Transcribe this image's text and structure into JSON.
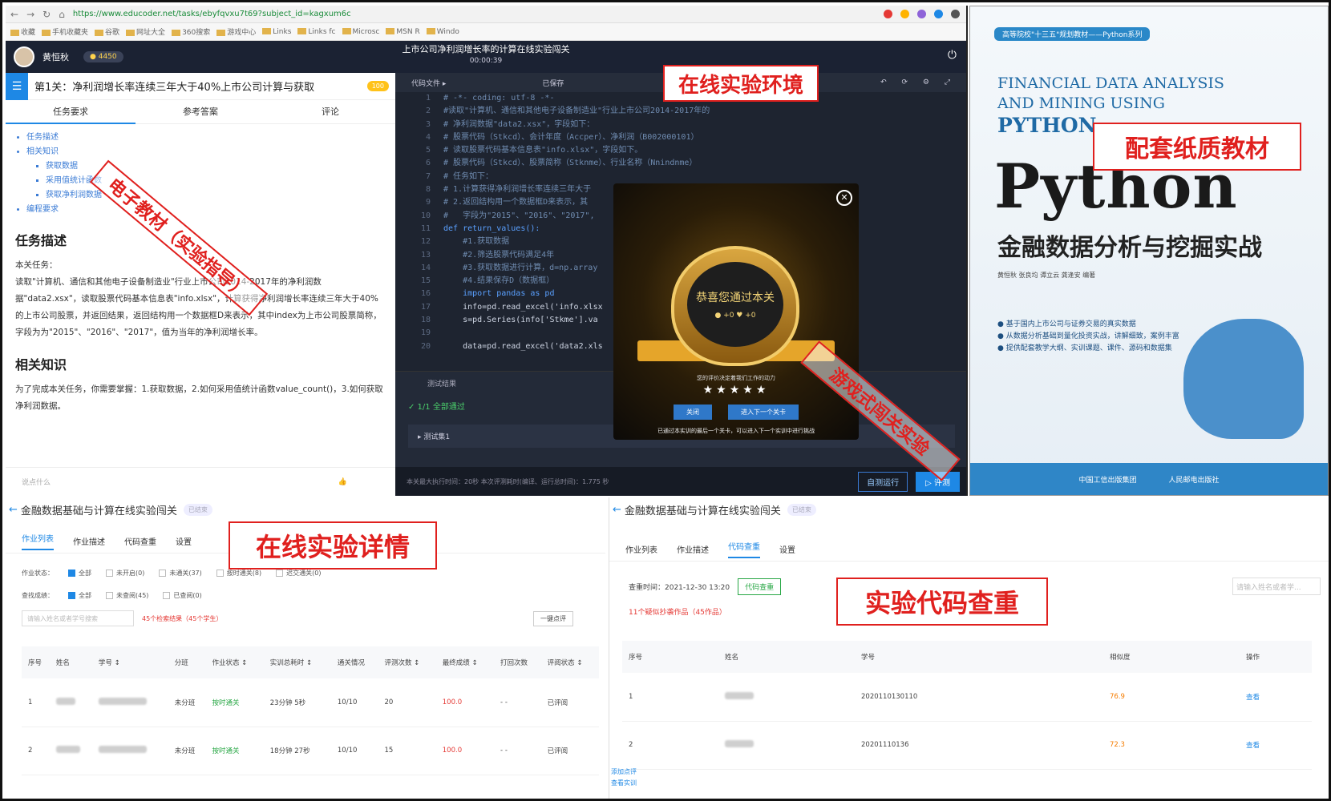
{
  "browser": {
    "url": "https://www.educoder.net/tasks/ebyfqvxu7t69?subject_id=kagxum6c",
    "bookmarks": [
      "收藏",
      "手机收藏夹",
      "谷歌",
      "网址大全",
      "360搜索",
      "游戏中心",
      "Links",
      "Links fc",
      "Microsc",
      "MSN R",
      "Windo"
    ]
  },
  "app": {
    "user_name": "黄恒秋",
    "coins": "4450",
    "title": "上市公司净利润增长率的计算在线实验闯关",
    "timer": "00:00:39"
  },
  "task": {
    "title": "第1关：净利润增长率连续三年大于40%上市公司计算与获取",
    "badge": "100",
    "tabs": [
      "任务要求",
      "参考答案",
      "评论"
    ],
    "toc": [
      "任务描述",
      "相关知识",
      "获取数据",
      "采用值统计函数",
      "获取净利润数据",
      "编程要求"
    ],
    "heading_desc": "任务描述",
    "intro": "本关任务：",
    "desc": "读取\"计算机、通信和其他电子设备制造业\"行业上市公司2014-2017年的净利润数据\"data2.xsx\"，读取股票代码基本信息表\"info.xlsx\"，计算获得净利润增长率连续三年大于40%的上市公司股票，并返回结果，返回结构用一个数据框D来表示，其中index为上市公司股票简称，字段为为\"2015\"、\"2016\"、\"2017\"，值为当年的净利润增长率。",
    "heading_know": "相关知识",
    "know": "为了完成本关任务，你需要掌握：1.获取数据，2.如何采用值统计函数value_count()，3.如何获取净利润数据。",
    "comment_placeholder": "说点什么"
  },
  "editor": {
    "file_label": "代码文件 ▸",
    "saved": "已保存",
    "lines": [
      {
        "n": "1",
        "t": "# -*- coding: utf-8 -*-",
        "c": ""
      },
      {
        "n": "2",
        "t": "#读取\"计算机、通信和其他电子设备制造业\"行业上市公司2014-2017年的",
        "c": ""
      },
      {
        "n": "3",
        "t": "# 净利润数据\"data2.xsx\"，字段如下：",
        "c": ""
      },
      {
        "n": "4",
        "t": "# 股票代码（Stkcd）、会计年度（Accper）、净利润（B002000101）",
        "c": ""
      },
      {
        "n": "5",
        "t": "# 读取股票代码基本信息表\"info.xlsx\"，字段如下。",
        "c": ""
      },
      {
        "n": "6",
        "t": "# 股票代码（Stkcd）、股票简称（Stknme）、行业名称（Nnindnme）",
        "c": ""
      },
      {
        "n": "7",
        "t": "# 任务如下：",
        "c": ""
      },
      {
        "n": "8",
        "t": "# 1.计算获得净利润增长率连续三年大于",
        "c": ""
      },
      {
        "n": "9",
        "t": "# 2.返回结构用一个数据框D来表示，其",
        "c": ""
      },
      {
        "n": "10",
        "t": "#   字段为\"2015\"、\"2016\"、\"2017\",",
        "c": ""
      },
      {
        "n": "11",
        "t": "def return_values():",
        "c": "kw"
      },
      {
        "n": "12",
        "t": "    #1.获取数据",
        "c": ""
      },
      {
        "n": "13",
        "t": "    #2.筛选股票代码满足4年",
        "c": ""
      },
      {
        "n": "14",
        "t": "    #3.获取数据进行计算，d=np.array",
        "c": ""
      },
      {
        "n": "15",
        "t": "    #4.结果保存D（数据框）",
        "c": ""
      },
      {
        "n": "16",
        "t": "    import pandas as pd",
        "c": "kw"
      },
      {
        "n": "17",
        "t": "    info=pd.read_excel('info.xlsx",
        "c": "tx"
      },
      {
        "n": "18",
        "t": "    s=pd.Series(info['Stkme'].va",
        "c": "tx"
      },
      {
        "n": "19",
        "t": "",
        "c": ""
      },
      {
        "n": "20",
        "t": "    data=pd.read_excel('data2.xls",
        "c": "tx"
      }
    ],
    "result_title": "测试结果",
    "pass": "✓ 1/1  全部通过",
    "case": "▸  测试集1",
    "footer": "本关最大执行时间：20秒    本次评测耗时(编译、运行总时间)：1.775 秒",
    "btn_run": "自测运行",
    "btn_eval": "▷ 评测"
  },
  "popup": {
    "congrats": "恭喜您通过本关",
    "stats": "● +0   ♥ +0",
    "msg": "您的评价决定着我们工作的动力",
    "stars": "★★★★★",
    "btn_close": "关闭",
    "btn_next": "进入下一个关卡",
    "foot": "已通过本实训的最后一个关卡，可以进入下一个实训中进行挑战"
  },
  "labels": {
    "online_env": "在线实验环境",
    "etextbook": "电子教材（实验指导）",
    "paper_textbook": "配套纸质教材",
    "game_levels": "游戏式闯关实验",
    "online_detail": "在线实验详情",
    "code_check": "实验代码查重"
  },
  "book": {
    "series": "高等院校\"十三五\"规划教材——Python系列",
    "en1": "FINANCIAL DATA ANALYSIS",
    "en2": "AND MINING USING",
    "en3": "PYTHON",
    "py": "Python",
    "cn": "金融数据分析与挖掘实战",
    "authors": "黄恒秋  张良均  谭立云  龚逢安 编著",
    "bullets": [
      "● 基于国内上市公司与证券交易的真实数据",
      "● 从数据分析基础到量化投资实战，讲解细致，案例丰富",
      "● 提供配套教学大纲、实训课题、课件、源码和数据集"
    ],
    "pub1": "中国工信出版集团",
    "pub2": "人民邮电出版社"
  },
  "left_panel": {
    "title": "金融数据基础与计算在线实验闯关",
    "tag": "已结束",
    "tabs": [
      "作业列表",
      "作业描述",
      "代码查重",
      "设置"
    ],
    "filter1_label": "作业状态：",
    "filter1": [
      "全部",
      "未开启(0)",
      "未通关(37)",
      "按时通关(8)",
      "迟交通关(0)"
    ],
    "filter2_label": "查找成绩：",
    "filter2": [
      "全部",
      "未查阅(45)",
      "已查阅(0)"
    ],
    "search_placeholder": "请输入姓名或者学号搜索",
    "count": "45个检索结果（45个学生）",
    "export": "一键点评",
    "headers": [
      "序号",
      "姓名",
      "学号 ↕",
      "分班",
      "作业状态 ↕",
      "实训总耗时 ↕",
      "通关情况",
      "评测次数 ↕",
      "最终成绩 ↕",
      "打回次数",
      "评阅状态 ↕"
    ],
    "rows": [
      [
        "1",
        "",
        "",
        "未分班",
        "按时通关",
        "23分钟 5秒",
        "10/10",
        "20",
        "100.0",
        "- -",
        "已评阅"
      ],
      [
        "2",
        "",
        "",
        "未分班",
        "按时通关",
        "18分钟 27秒",
        "10/10",
        "15",
        "100.0",
        "- -",
        "已评阅"
      ]
    ]
  },
  "right_panel": {
    "title": "金融数据基础与计算在线实验闯关",
    "tag": "已结束",
    "tabs": [
      "作业列表",
      "作业描述",
      "代码查重",
      "设置"
    ],
    "check_time": "查重时间：2021-12-30 13:20",
    "check_btn": "代码查重",
    "search_placeholder": "请输入姓名或者学...",
    "summary": "11个疑似抄袭作品（45作品）",
    "headers": [
      "序号",
      "姓名",
      "学号",
      "相似度",
      "操作"
    ],
    "rows": [
      [
        "1",
        "",
        "2020110130110",
        "76.9",
        "查看"
      ],
      [
        "2",
        "",
        "20201110136",
        "72.3",
        "查看"
      ]
    ],
    "side_links": [
      "添加点评",
      "查看实训"
    ]
  }
}
